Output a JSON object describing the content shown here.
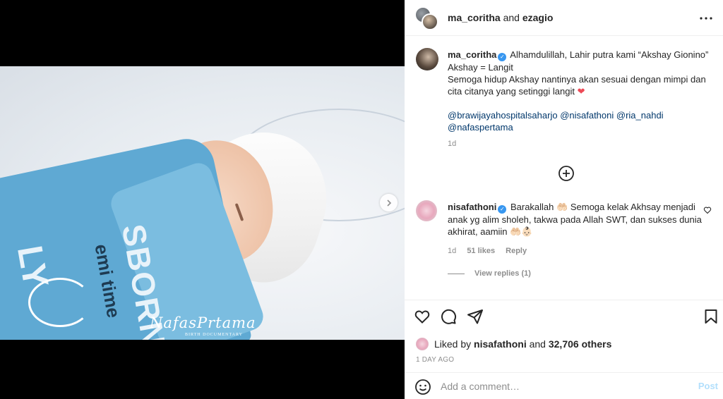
{
  "post": {
    "header": {
      "author": "ma_coritha",
      "joiner": "and",
      "collaborator": "ezagio"
    },
    "image": {
      "watermark_main": "NafasPrtama",
      "watermark_sub": "BIRTH DOCUMENTARY",
      "blanket_text_1": "SBORN",
      "blanket_text_2": "emi time",
      "blanket_text_3": "LY"
    },
    "caption": {
      "username": "ma_coritha",
      "line1": "Alhamdulillah, Lahir putra kami “Akshay Gionino”",
      "line2": "Akshay = Langit",
      "line3": "Semoga hidup Akshay nantinya akan sesuai dengan mimpi dan cita citanya yang setinggi langit",
      "mentions": [
        "@brawijayahospitalsaharjo",
        "@nisafathoni",
        "@ria_nahdi",
        "@nafaspertama"
      ],
      "age": "1d"
    },
    "comments": [
      {
        "username": "nisafathoni",
        "text_part1": "Barakallah",
        "text_part2": "Semoga kelak Akhsay menjadi anak yg alim sholeh, takwa pada Allah SWT, dan sukses dunia akhirat, aamiin",
        "age": "1d",
        "likes": "51 likes",
        "reply_label": "Reply",
        "view_replies": "View replies (1)"
      }
    ],
    "likes": {
      "prefix": "Liked by",
      "user": "nisafathoni",
      "joiner": "and",
      "others": "32,706 others"
    },
    "timestamp": "1 DAY AGO",
    "comment_box": {
      "placeholder": "Add a comment…",
      "post_label": "Post"
    }
  },
  "icons": {
    "more": "more-horizontal-icon",
    "next": "chevron-right-icon",
    "load_more": "plus-circle-icon",
    "like": "heart-icon",
    "comment": "comment-icon",
    "share": "share-icon",
    "save": "bookmark-icon",
    "emoji": "smiley-icon"
  },
  "colors": {
    "verified": "#3897f0",
    "mention": "#00376b",
    "heart": "#ed4956",
    "muted": "#8e8e8e",
    "post_disabled": "#b2dffc"
  }
}
